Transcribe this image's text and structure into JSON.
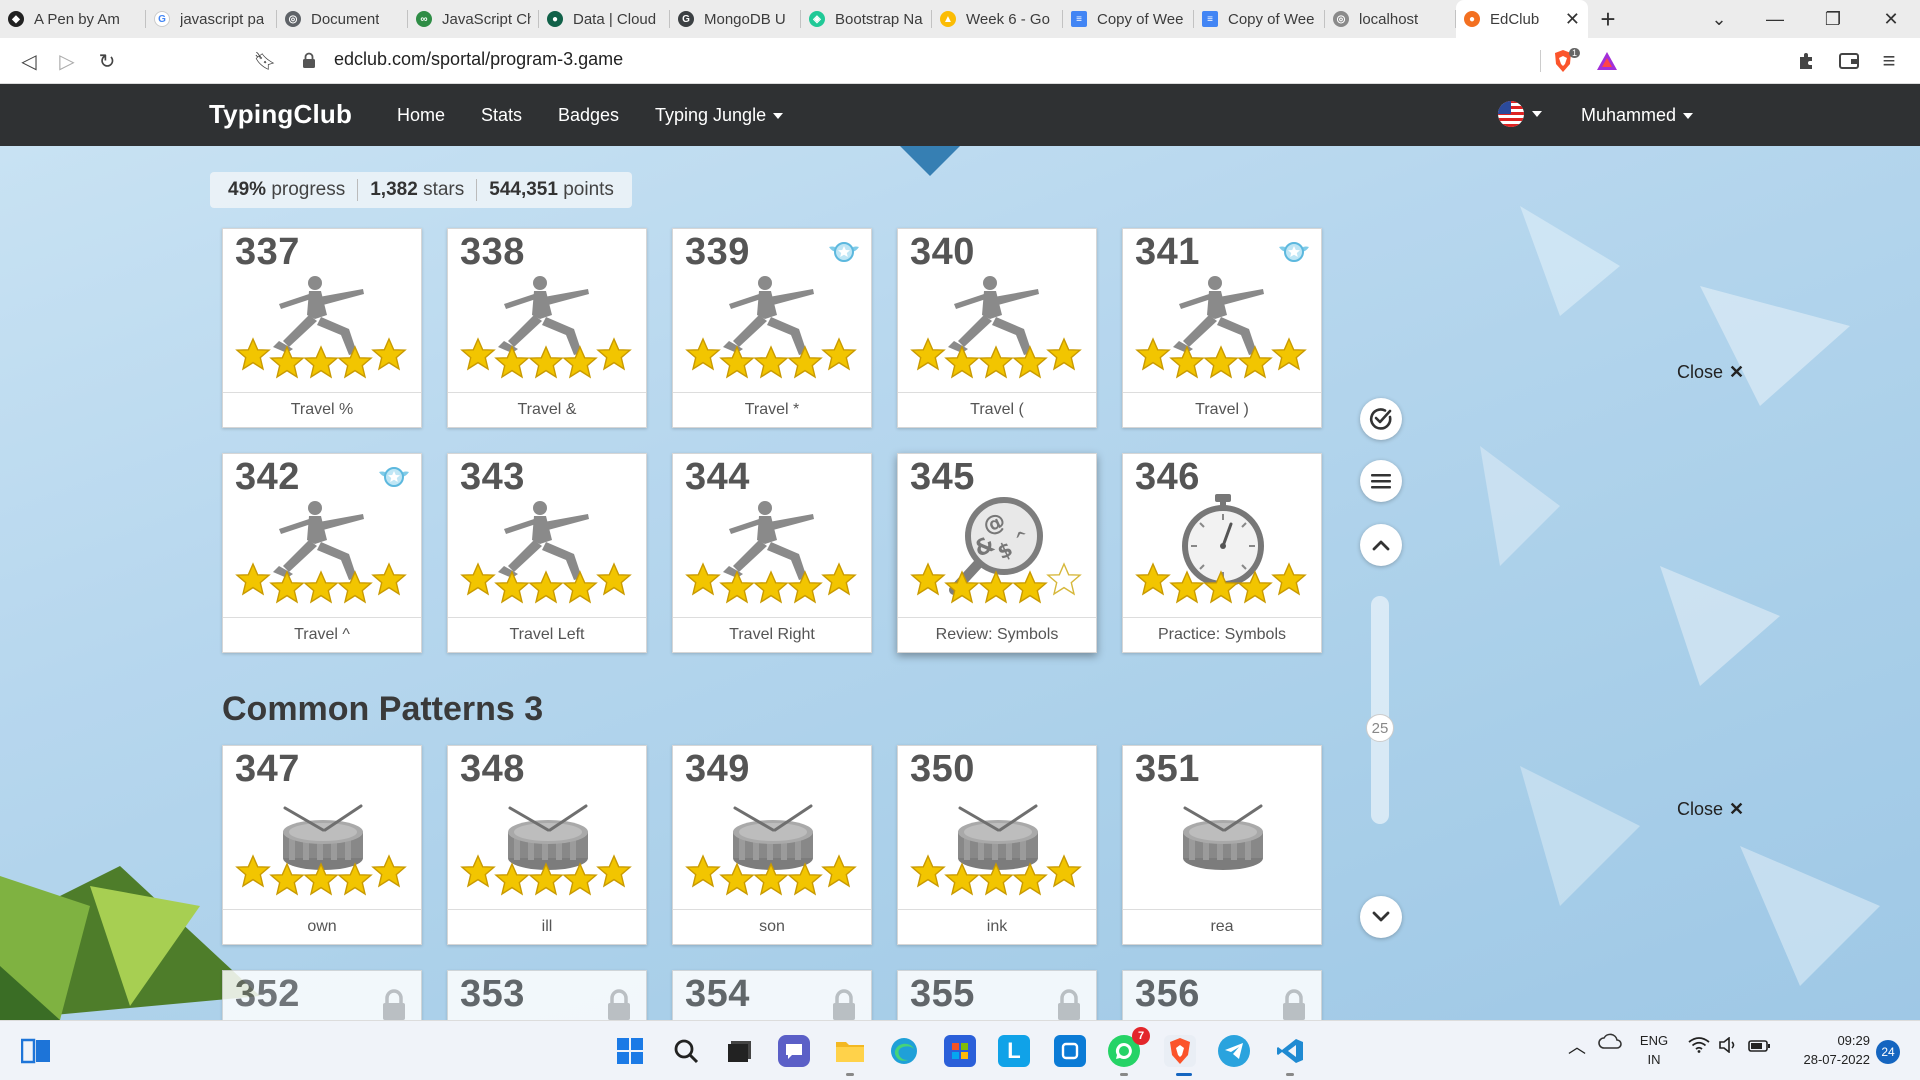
{
  "browser": {
    "tabs": [
      {
        "title": "A Pen by Am",
        "color": "#222222",
        "glyph": "◆"
      },
      {
        "title": "javascript pa",
        "color": "#4285f4",
        "glyph": "G"
      },
      {
        "title": "Document",
        "color": "#5f6368",
        "glyph": "◎"
      },
      {
        "title": "JavaScript Ch",
        "color": "#2f8d46",
        "glyph": "∞"
      },
      {
        "title": "Data | Cloud",
        "color": "#116149",
        "glyph": "●"
      },
      {
        "title": "MongoDB U",
        "color": "#3c4043",
        "glyph": "G"
      },
      {
        "title": "Bootstrap Na",
        "color": "#20c997",
        "glyph": "◈"
      },
      {
        "title": "Week 6 - Go",
        "color": "#fbbc04",
        "glyph": "▲"
      },
      {
        "title": "Copy of Wee",
        "color": "#4285f4",
        "glyph": "≡"
      },
      {
        "title": "Copy of Wee",
        "color": "#4285f4",
        "glyph": "≡"
      },
      {
        "title": "localhost",
        "color": "#8a8a8a",
        "glyph": "◎"
      }
    ],
    "active_tab": {
      "title": "EdClub",
      "color": "#f37021"
    },
    "url": "edclub.com/sportal/program-3.game",
    "brave_badge": "1"
  },
  "site": {
    "brand": "TypingClub",
    "nav": {
      "home": "Home",
      "stats": "Stats",
      "badges": "Badges",
      "jungle": "Typing Jungle"
    },
    "user": "Muhammed"
  },
  "progress": {
    "percent": "49%",
    "percent_label": "progress",
    "stars": "1,382",
    "stars_label": "stars",
    "points": "544,351",
    "points_label": "points"
  },
  "lessons": {
    "row1": [
      {
        "num": "337",
        "label": "Travel %",
        "stars": 5,
        "badge": false
      },
      {
        "num": "338",
        "label": "Travel &",
        "stars": 5,
        "badge": false
      },
      {
        "num": "339",
        "label": "Travel *",
        "stars": 5,
        "badge": true
      },
      {
        "num": "340",
        "label": "Travel (",
        "stars": 5,
        "badge": false
      },
      {
        "num": "341",
        "label": "Travel )",
        "stars": 5,
        "badge": true
      }
    ],
    "row2": [
      {
        "num": "342",
        "label": "Travel ^",
        "stars": 5,
        "badge": true
      },
      {
        "num": "343",
        "label": "Travel Left",
        "stars": 5,
        "badge": false
      },
      {
        "num": "344",
        "label": "Travel Right",
        "stars": 5,
        "badge": false
      },
      {
        "num": "345",
        "label": "Review: Symbols",
        "stars": 4,
        "badge": false
      },
      {
        "num": "346",
        "label": "Practice: Symbols",
        "stars": 5,
        "badge": false
      }
    ],
    "section_title": "Common Patterns 3",
    "row3": [
      {
        "num": "347",
        "label": "own",
        "stars": 5
      },
      {
        "num": "348",
        "label": "ill",
        "stars": 5
      },
      {
        "num": "349",
        "label": "son",
        "stars": 5
      },
      {
        "num": "350",
        "label": "ink",
        "stars": 5
      },
      {
        "num": "351",
        "label": "rea",
        "stars": 0
      }
    ],
    "row4": [
      {
        "num": "352"
      },
      {
        "num": "353"
      },
      {
        "num": "354"
      },
      {
        "num": "355"
      },
      {
        "num": "356"
      }
    ]
  },
  "sidebar": {
    "close_label": "Close",
    "close_glyph": "✕",
    "slider_value": "25"
  },
  "taskbar": {
    "whatsapp_badge": "7",
    "lang_line1": "ENG",
    "lang_line2": "IN",
    "time": "09:29",
    "date": "28-07-2022",
    "notifications": "24"
  }
}
